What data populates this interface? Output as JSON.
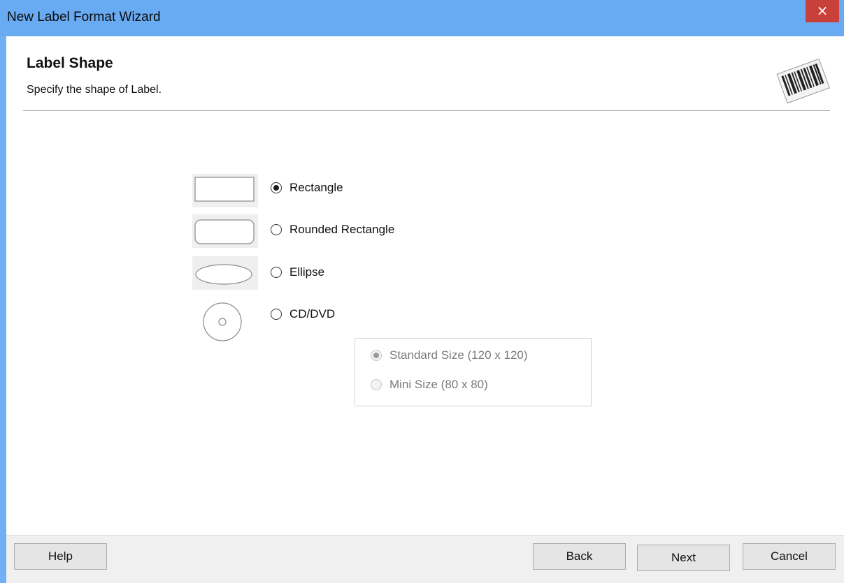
{
  "window": {
    "title": "New Label Format Wizard",
    "close_label": "×"
  },
  "header": {
    "title": "Label Shape",
    "subtitle": "Specify the shape of Label.",
    "icon": "barcode-icon"
  },
  "shapes": [
    {
      "label": "Rectangle",
      "selected": true,
      "icon": "rectangle-icon"
    },
    {
      "label": "Rounded Rectangle",
      "selected": false,
      "icon": "rounded-rectangle-icon"
    },
    {
      "label": "Ellipse",
      "selected": false,
      "icon": "ellipse-icon"
    },
    {
      "label": "CD/DVD",
      "selected": false,
      "icon": "cd-dvd-icon"
    }
  ],
  "cd_options": [
    {
      "label": "Standard Size (120 x 120)",
      "selected": true,
      "enabled": false
    },
    {
      "label": "Mini Size (80 x 80)",
      "selected": false,
      "enabled": false
    }
  ],
  "buttons": {
    "help": "Help",
    "back": "Back",
    "next": "Next",
    "cancel": "Cancel"
  },
  "colors": {
    "titlebar": "#69abf2",
    "close": "#c7403a",
    "footer": "#f0f0f0"
  }
}
